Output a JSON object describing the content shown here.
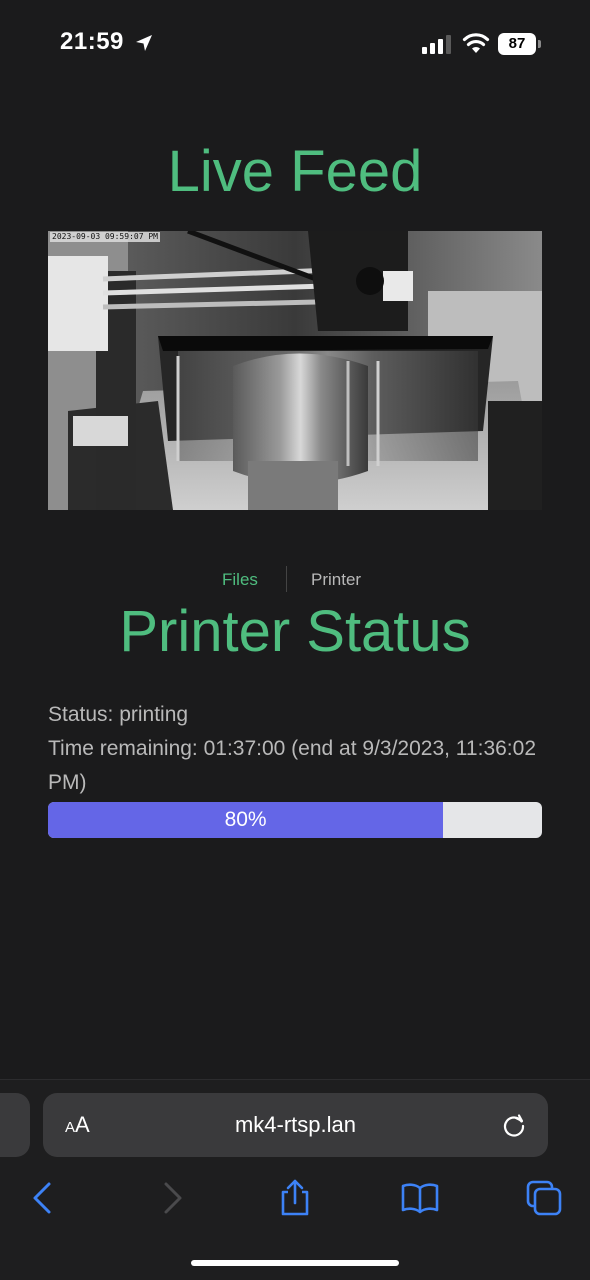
{
  "status_bar": {
    "time": "21:59",
    "battery_level": "87",
    "icons": [
      "location-arrow-icon",
      "cellular-signal-icon",
      "wifi-icon",
      "battery-icon"
    ]
  },
  "live_feed": {
    "title": "Live Feed",
    "timestamp": "2023-09-03 09:59:07 PM"
  },
  "nav": {
    "files_label": "Files",
    "printer_label": "Printer"
  },
  "printer_status": {
    "title": "Printer Status",
    "status_line": "Status: printing",
    "time_line": "Time remaining: 01:37:00 (end at 9/3/2023, 11:36:02 PM)",
    "progress_label": "80%",
    "progress_fraction": 0.8,
    "progress_color": "#6466e7",
    "track_color": "#e5e6e8"
  },
  "browser": {
    "text_size_button": "AA",
    "url": "mk4-rtsp.lan",
    "toolbar_icons": [
      "back-icon",
      "forward-icon",
      "share-icon",
      "bookmarks-icon",
      "tabs-icon"
    ],
    "accent_color": "#3d82f6"
  },
  "theme": {
    "accent_green": "#4fbd7f",
    "background": "#1b1b1c",
    "text_gray": "#b9b9b9"
  }
}
